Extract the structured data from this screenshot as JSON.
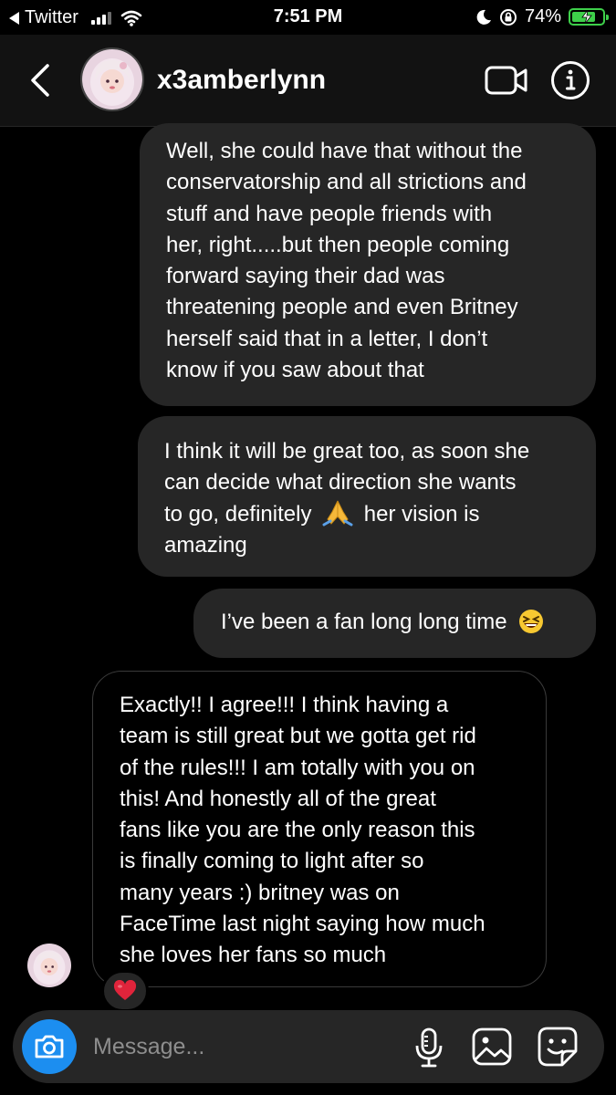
{
  "status_bar": {
    "back_app": "Twitter",
    "time": "7:51 PM",
    "battery": "74%",
    "battery_level": 0.74,
    "icons": [
      "signal-icon",
      "wifi-icon",
      "moon-icon",
      "rotation-lock-icon",
      "battery-charging-icon"
    ]
  },
  "header": {
    "username": "x3amberlynn",
    "icons": [
      "back-chevron-icon",
      "avatar",
      "video-call-icon",
      "info-icon"
    ]
  },
  "messages": [
    {
      "direction": "sent",
      "lines": [
        "Well, she could have that without the",
        "conservatorship and all strictions and",
        "stuff and have people friends with",
        "her, right.....but then people coming",
        "forward saying their dad was",
        "threatening people and even Britney",
        "herself said that in a letter, I don’t",
        "know if you saw about that"
      ]
    },
    {
      "direction": "sent",
      "lines": [
        "I think it will be great too, as soon she",
        "can decide what direction she wants",
        "to go, definitely",
        "her vision is",
        "amazing"
      ],
      "emoji": "folded-hands"
    },
    {
      "direction": "sent",
      "lines": [
        "I’ve been a fan long long time"
      ],
      "emoji": "grinning-squinting-face"
    },
    {
      "direction": "received",
      "lines": [
        "Exactly!! I agree!!! I think having a",
        "team is still great but we gotta get rid",
        "of the rules!!! I am totally with you on",
        "this! And honestly all of the great",
        "fans like you are the only reason this",
        "is finally coming to light after so",
        "many years :) britney was on",
        "FaceTime last night saying how much",
        "she loves her fans so much"
      ],
      "reaction": "red-heart"
    }
  ],
  "composer": {
    "placeholder": "Message...",
    "icons": [
      "camera-icon",
      "microphone-icon",
      "gallery-icon",
      "sticker-icon"
    ]
  },
  "colors": {
    "background": "#000000",
    "sent_bubble": "#262626",
    "camera_button": "#1c8ef0",
    "battery": "#3ecf4a",
    "reaction_heart": "#e0243b"
  }
}
